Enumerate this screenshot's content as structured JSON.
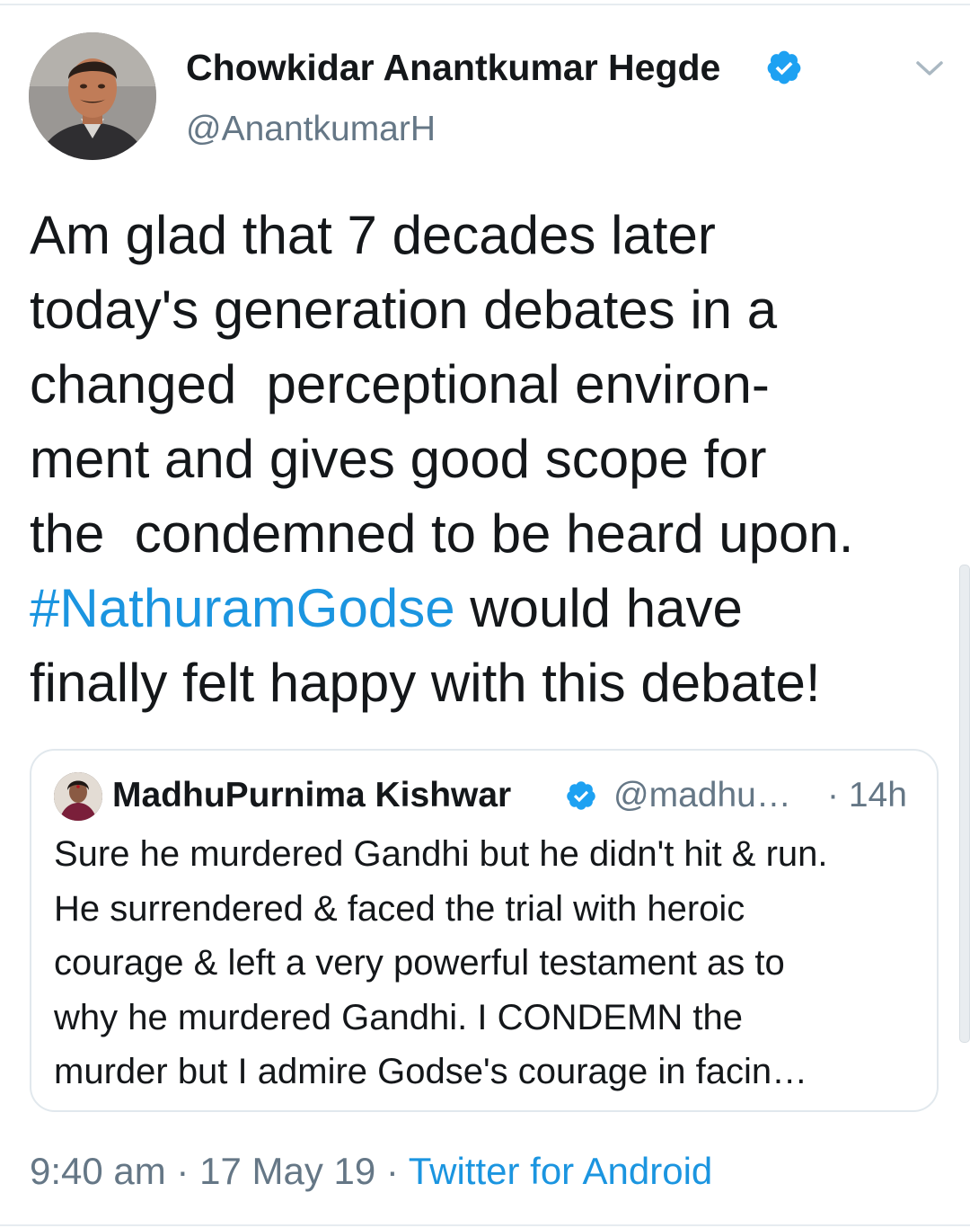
{
  "tweet": {
    "author": {
      "display_name": "Chowkidar Anantkumar Hegde",
      "handle": "@AnantkumarH",
      "verified": true,
      "avatar_icon": "profile-photo"
    },
    "menu_icon": "chevron-down-icon",
    "text_lines": [
      "Am glad that 7 decades later",
      "today's generation debates in a",
      "changed  perceptional environ-",
      "ment and gives good scope for",
      "the  condemned to be heard upon."
    ],
    "hashtag": "#NathuramGodse",
    "text_after_hashtag": " would have",
    "text_last_line": "finally felt happy with this debate!",
    "time": "9:40 am",
    "separator": " · ",
    "date": "17 May 19",
    "source": "Twitter for Android"
  },
  "quoted_tweet": {
    "author": {
      "display_name": "MadhuPurnima Kishwar",
      "handle": "@madhu…",
      "verified": true,
      "avatar_icon": "profile-photo"
    },
    "time_ago": "· 14h",
    "text_lines": [
      "Sure he murdered Gandhi but he didn't hit & run.",
      "He surrendered & faced the trial with heroic",
      "courage & left a very powerful testament as to",
      "why he murdered Gandhi. I CONDEMN the",
      "murder but I admire Godse's courage in facin…"
    ]
  },
  "colors": {
    "link": "#1b95e0",
    "text": "#14171a",
    "secondary": "#657786",
    "verified": "#1da1f2",
    "border": "#e1e8ed"
  }
}
